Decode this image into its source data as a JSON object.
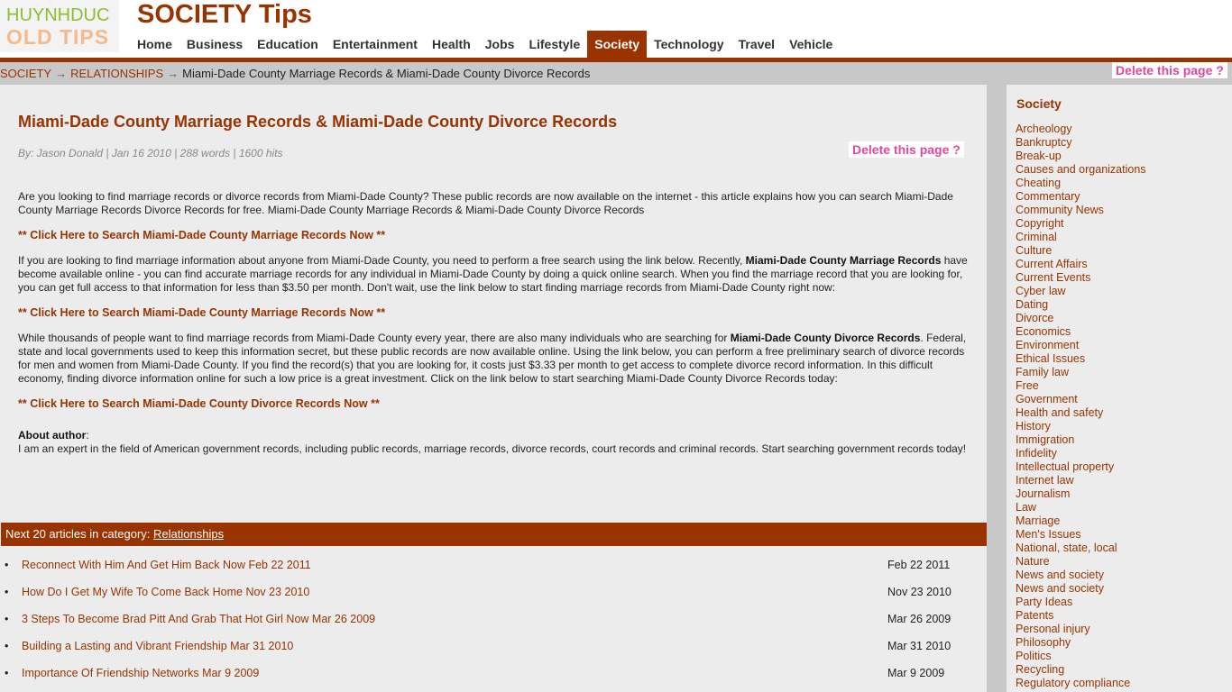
{
  "logo": {
    "line1": "HUYNHDUC",
    "line2": "OLD TIPS"
  },
  "site_title": "SOCIETY Tips",
  "nav": [
    "Home",
    "Business",
    "Education",
    "Entertainment",
    "Health",
    "Jobs",
    "Lifestyle",
    "Society",
    "Technology",
    "Travel",
    "Vehicle"
  ],
  "nav_active": "Society",
  "breadcrumb": {
    "root": "SOCIETY",
    "category": "RELATIONSHIPS",
    "current": "Miami-Dade County Marriage Records & Miami-Dade County Divorce Records",
    "separator": "→"
  },
  "delete_label": "Delete this page ?",
  "article": {
    "title": "Miami-Dade County Marriage Records & Miami-Dade County Divorce Records",
    "byline": "By: Jason Donald | Jan 16 2010 | 288 words | 1600 hits",
    "p1": "Are you looking to find marriage records or divorce records from Miami-Dade County? These public records are now available on the internet - this article explains how you can search Miami-Dade County Marriage Records Divorce Records for free. Miami-Dade County Marriage Records & Miami-Dade County Divorce Records",
    "cta1": "** Click Here to Search Miami-Dade County Marriage Records Now **",
    "p2_a": "If you are looking to find marriage information about anyone from Miami-Dade County, you need to perform a free search using the link below. Recently, ",
    "p2_b": "Miami-Dade County Marriage Records",
    "p2_c": " have become available online - you can find accurate marriage records for any individual in Miami-Dade County by doing a quick online search. When you find the marriage record that you are looking for, you can get full access to that information for less than $3.50 per month. Don't wait, use the link below to start finding marriage records from Miami-Dade County right now:",
    "cta2": "** Click Here to Search Miami-Dade County Marriage Records Now **",
    "p3_a": "While thousands of people want to find marriage records from Miami-Dade County every year, there are also many individuals who are searching for ",
    "p3_b": "Miami-Dade County Divorce Records",
    "p3_c": ". Federal, state and local governments used to keep this information secret, but these public records are now available online. Using the link below, you can perform a free preliminary search of divorce records for men and women from Miami-Dade County. If you find the record(s) that you are looking for, it costs just $3.33 per month to get access to complete divorce record information. In this difficult economy, finding divorce information online for such a low price is a great investment. Click on the link below to start searching Miami-Dade County Divorce Records today:",
    "cta3": "** Click Here to Search Miami-Dade County Divorce Records Now **",
    "about_label": "About author",
    "about_colon": ":",
    "about_text": "I am an expert in the field of American government records, including public records, marriage records, divorce records, court records and criminal records. Start searching government records today!"
  },
  "next": {
    "label": "Next 20 articles in category: ",
    "category": "Relationships",
    "items": [
      {
        "title": "Reconnect With Him And Get Him Back Now Feb 22 2011",
        "date": "Feb 22 2011"
      },
      {
        "title": "How Do I Get My Wife To Come Back Home Nov 23 2010",
        "date": "Nov 23 2010"
      },
      {
        "title": "3 Steps To Become Brad Pitt And Grab That Hot Girl Now Mar 26 2009",
        "date": "Mar 26 2009"
      },
      {
        "title": "Building a Lasting and Vibrant Friendship Mar 31 2010",
        "date": "Mar 31 2010"
      },
      {
        "title": "Importance Of Friendship Networks Mar 9 2009",
        "date": "Mar 9 2009"
      }
    ]
  },
  "sidebar": {
    "heading": "Society",
    "items": [
      "Archeology",
      "Bankruptcy",
      "Break-up",
      "Causes and organizations",
      "Cheating",
      "Commentary",
      "Community News",
      "Copyright",
      "Criminal",
      "Culture",
      "Current Affairs",
      "Current Events",
      "Cyber law",
      "Dating",
      "Divorce",
      "Economics",
      "Environment",
      "Ethical Issues",
      "Family law",
      "Free",
      "Government",
      "Health and safety",
      "History",
      "Immigration",
      "Infidelity",
      "Intellectual property",
      "Internet law",
      "Journalism",
      "Law",
      "Marriage",
      "Men's Issues",
      "National, state, local",
      "Nature",
      "News and society",
      "News and society",
      "Party Ideas",
      "Patents",
      "Personal injury",
      "Philosophy",
      "Politics",
      "Recycling",
      "Regulatory compliance"
    ]
  },
  "colors": {
    "brand": "#993300",
    "delete": "#e0479e"
  }
}
